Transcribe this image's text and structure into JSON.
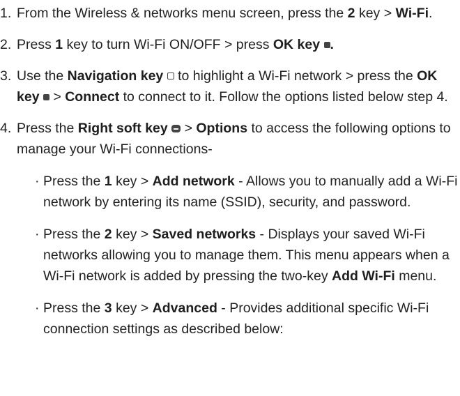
{
  "steps": [
    {
      "num": "1.",
      "t1": "From the Wireless & networks menu screen, press the ",
      "b1": "2",
      "t2": " key > ",
      "b2": "Wi-Fi",
      "t3": "."
    },
    {
      "num": "2.",
      "t1": "Press ",
      "b1": "1",
      "t2": " key to turn Wi-Fi ON/OFF > press ",
      "b2": "OK key",
      "t3": ""
    },
    {
      "num": "3.",
      "t1": "Use the ",
      "b1": "Navigation key",
      "t2": " to highlight a Wi-Fi network > press the ",
      "b2": "OK key",
      "t3": " > ",
      "b3": "Connect",
      "t4": " to connect to it. Follow the options listed below step 4."
    },
    {
      "num": "4.",
      "t1": "Press the ",
      "b1": "Right soft key",
      "t2": " > ",
      "b2": "Options",
      "t3": " to access the following options to manage your Wi-Fi connections-"
    }
  ],
  "options": [
    {
      "t1": "Press the ",
      "b1": "1",
      "t2": " key > ",
      "b2": "Add network",
      "t3": " - Allows you to manually add a Wi-Fi network by entering its name (SSID), security, and password."
    },
    {
      "t1": "Press the ",
      "b1": "2",
      "t2": " key > ",
      "b2": "Saved networks",
      "t3": " - Displays your saved Wi-Fi networks allowing you to manage them. This menu appears when a Wi-Fi network is added by pressing the two-key ",
      "b3": "Add Wi-Fi",
      "t4": " menu."
    },
    {
      "t1": "Press the ",
      "b1": "3",
      "t2": " key > ",
      "b2": "Advanced",
      "t3": " - Provides additional specific Wi-Fi connection settings as described below:"
    }
  ],
  "icons": {
    "ok_key": "ok-key-icon",
    "navigation_key": "navigation-key-icon",
    "right_soft_key": "right-soft-key-icon"
  }
}
